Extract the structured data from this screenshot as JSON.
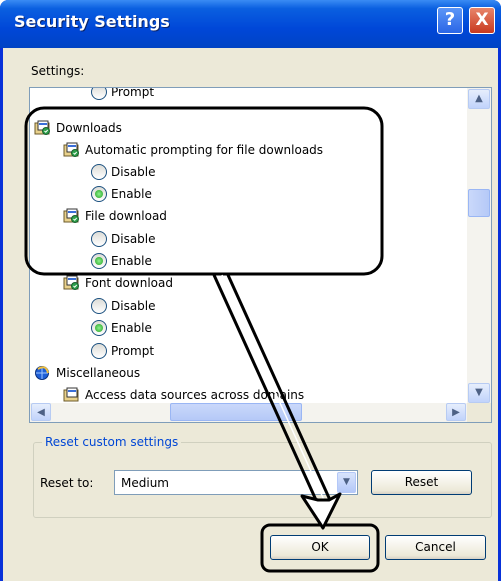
{
  "window": {
    "title": "Security Settings"
  },
  "titlebar": {
    "help_glyph": "?",
    "close_glyph": "X"
  },
  "settings_label": "Settings:",
  "tree": {
    "items": [
      {
        "type": "radio",
        "label": "Prompt",
        "checked": false,
        "partial": true
      },
      {
        "type": "category",
        "label": "Downloads",
        "icon": "settings-folder-icon"
      },
      {
        "type": "setting",
        "label": "Automatic prompting for file downloads",
        "icon": "settings-folder-icon"
      },
      {
        "type": "radio",
        "label": "Disable",
        "checked": false
      },
      {
        "type": "radio",
        "label": "Enable",
        "checked": true
      },
      {
        "type": "setting",
        "label": "File download",
        "icon": "settings-folder-icon"
      },
      {
        "type": "radio",
        "label": "Disable",
        "checked": false
      },
      {
        "type": "radio",
        "label": "Enable",
        "checked": true
      },
      {
        "type": "setting",
        "label": "Font download",
        "icon": "settings-folder-icon"
      },
      {
        "type": "radio",
        "label": "Disable",
        "checked": false
      },
      {
        "type": "radio",
        "label": "Enable",
        "checked": true
      },
      {
        "type": "radio",
        "label": "Prompt",
        "checked": false
      },
      {
        "type": "category",
        "label": "Miscellaneous",
        "icon": "ie-globe-icon"
      },
      {
        "type": "setting",
        "label": "Access data sources across domains",
        "icon": "settings-folder-icon",
        "partial": true
      }
    ]
  },
  "reset_group": {
    "title": "Reset custom settings",
    "reset_to_label": "Reset to:",
    "selected_level": "Medium",
    "reset_button": "Reset"
  },
  "footer": {
    "ok_label": "OK",
    "cancel_label": "Cancel"
  },
  "colors": {
    "title_bar": "#0054e3",
    "dialog_bg": "#ece9d8",
    "group_title": "#0046d5",
    "radio_checked": "#21a121"
  }
}
